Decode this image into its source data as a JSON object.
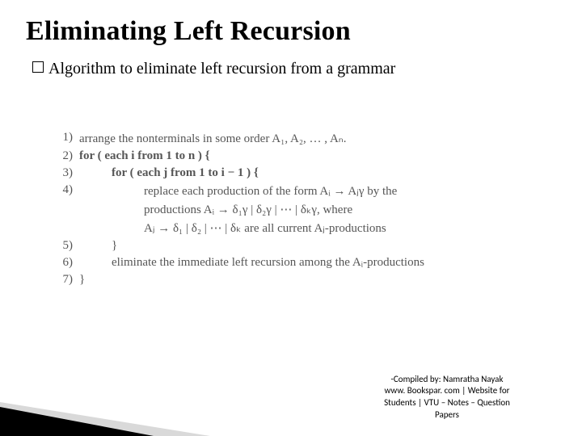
{
  "title": "Eliminating Left Recursion",
  "bullet": "Algorithm to eliminate left recursion from a grammar",
  "algo": {
    "l1_num": "1)",
    "l1": "arrange the nonterminals in some order A₁, A₂, … , Aₙ.",
    "l2_num": "2)",
    "l2": "for ( each i from 1 to n ) {",
    "l3_num": "3)",
    "l3": "for ( each j from 1 to i − 1 ) {",
    "l4_num": "4)",
    "l4a": "replace each production of the form Aᵢ → Aⱼγ by the",
    "l4b": "productions Aᵢ → δ₁γ | δ₂γ | ⋯ | δₖγ, where",
    "l4c": "Aⱼ → δ₁ | δ₂ | ⋯ | δₖ are all current Aⱼ-productions",
    "l5_num": "5)",
    "l5": "}",
    "l6_num": "6)",
    "l6": "eliminate the immediate left recursion among the Aᵢ-productions",
    "l7_num": "7)",
    "l7": "}"
  },
  "footer": {
    "line1": "-Compiled by: Namratha Nayak",
    "line2": "www. Bookspar. com | Website for",
    "line3": "Students | VTU – Notes – Question",
    "line4": "Papers"
  }
}
